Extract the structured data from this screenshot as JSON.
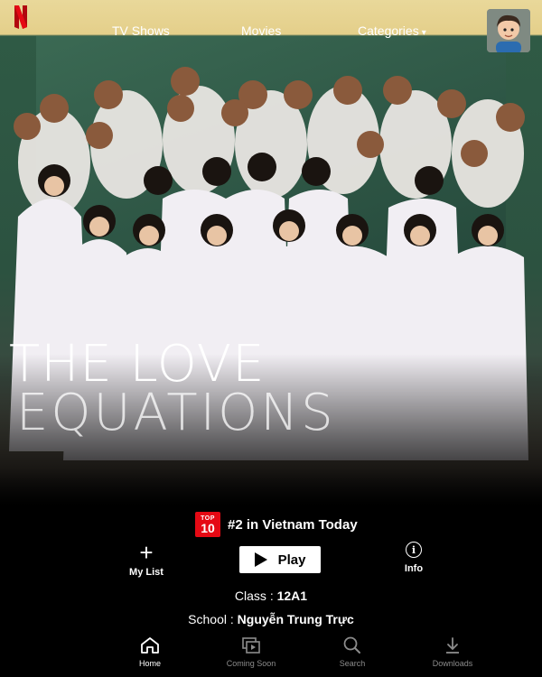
{
  "nav": {
    "tv_shows": "TV Shows",
    "movies": "Movies",
    "categories": "Categories",
    "categories_caret": "▾"
  },
  "hero": {
    "title_line1": "THE LOVE",
    "title_line2": "EQUATIONS"
  },
  "rank": {
    "badge_top": "TOP",
    "badge_num": "10",
    "text": "#2 in Vietnam Today"
  },
  "actions": {
    "my_list": "My List",
    "play": "Play",
    "info": "Info"
  },
  "meta": {
    "class_label": "Class : ",
    "class_value": "12A1",
    "school_label": "School : ",
    "school_value": "Nguyễn Trung Trực"
  },
  "bottom_nav": {
    "home": "Home",
    "coming_soon": "Coming Soon",
    "search": "Search",
    "downloads": "Downloads"
  },
  "colors": {
    "brand_red": "#e50914",
    "inactive_tab": "#8c8c8c"
  },
  "icons": [
    "netflix-logo-icon",
    "profile-avatar-icon",
    "plus-icon",
    "play-icon",
    "info-icon",
    "home-icon",
    "coming-soon-icon",
    "search-icon",
    "download-icon"
  ]
}
